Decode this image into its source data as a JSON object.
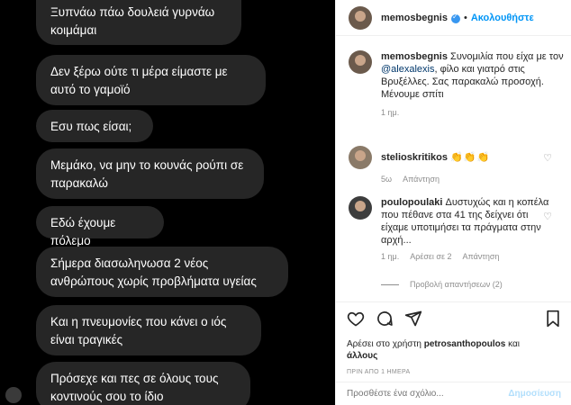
{
  "chat": {
    "messages": [
      "Ξυπνάω πάω δουλειά γυρνάω κοιμάμαι",
      "Δεν ξέρω ούτε τι μέρα είμαστε με αυτό το γαμοϊό",
      "Εσυ πως είσαι;",
      "Μεμάκο, να μην το κουνάς ρούπι σε παρακαλώ",
      "Εδώ έχουμε πόλεμο",
      "Σήμερα διασωληνωσα 2 νέος ανθρώπους χωρίς προβλήματα υγείας",
      "Και η πνευμονίες που κάνει ο ιός είναι τραγικές",
      "Πρόσεχε και πες σε όλους τους κοντινούς σου το ίδιο"
    ]
  },
  "header": {
    "username": "memosbegnis",
    "separator": "•",
    "follow_label": "Ακολουθήστε",
    "more_label": "···"
  },
  "caption": {
    "username": "memosbegnis",
    "text_before": " Συνομιλία που είχα με τον ",
    "mention": "@alexalexis",
    "text_after": ", φίλο και γιατρό στις Βρυξέλλες. Σας παρακαλώ προσοχή. Μένουμε σπίτι",
    "time": "1 ημ."
  },
  "comments": [
    {
      "username": "stelioskritikos",
      "text": "👏👏👏",
      "time": "5ω",
      "reply_label": "Απάντηση"
    },
    {
      "username": "poulopoulaki",
      "text": " Δυστυχώς και η κοπέλα που πέθανε στα 41 της δείχνει ότι είχαμε υποτιμήσει τα πράγματα στην αρχή...",
      "time": "1 ημ.",
      "likes_label": "Αρέσει σε 2",
      "reply_label": "Απάντηση",
      "view_replies_label": "Προβολή απαντήσεων (2)"
    }
  ],
  "actions": {
    "likes_prefix": "Αρέσει στο χρήστη ",
    "likes_user": "petrosanthopoulos",
    "likes_and": " και",
    "likes_others": "άλλους",
    "date": "ΠΡΙΝ ΑΠΟ 1 ΗΜΕΡΑ"
  },
  "comment_box": {
    "placeholder": "Προσθέστε ένα σχόλιο...",
    "post_label": "Δημοσίευση"
  }
}
